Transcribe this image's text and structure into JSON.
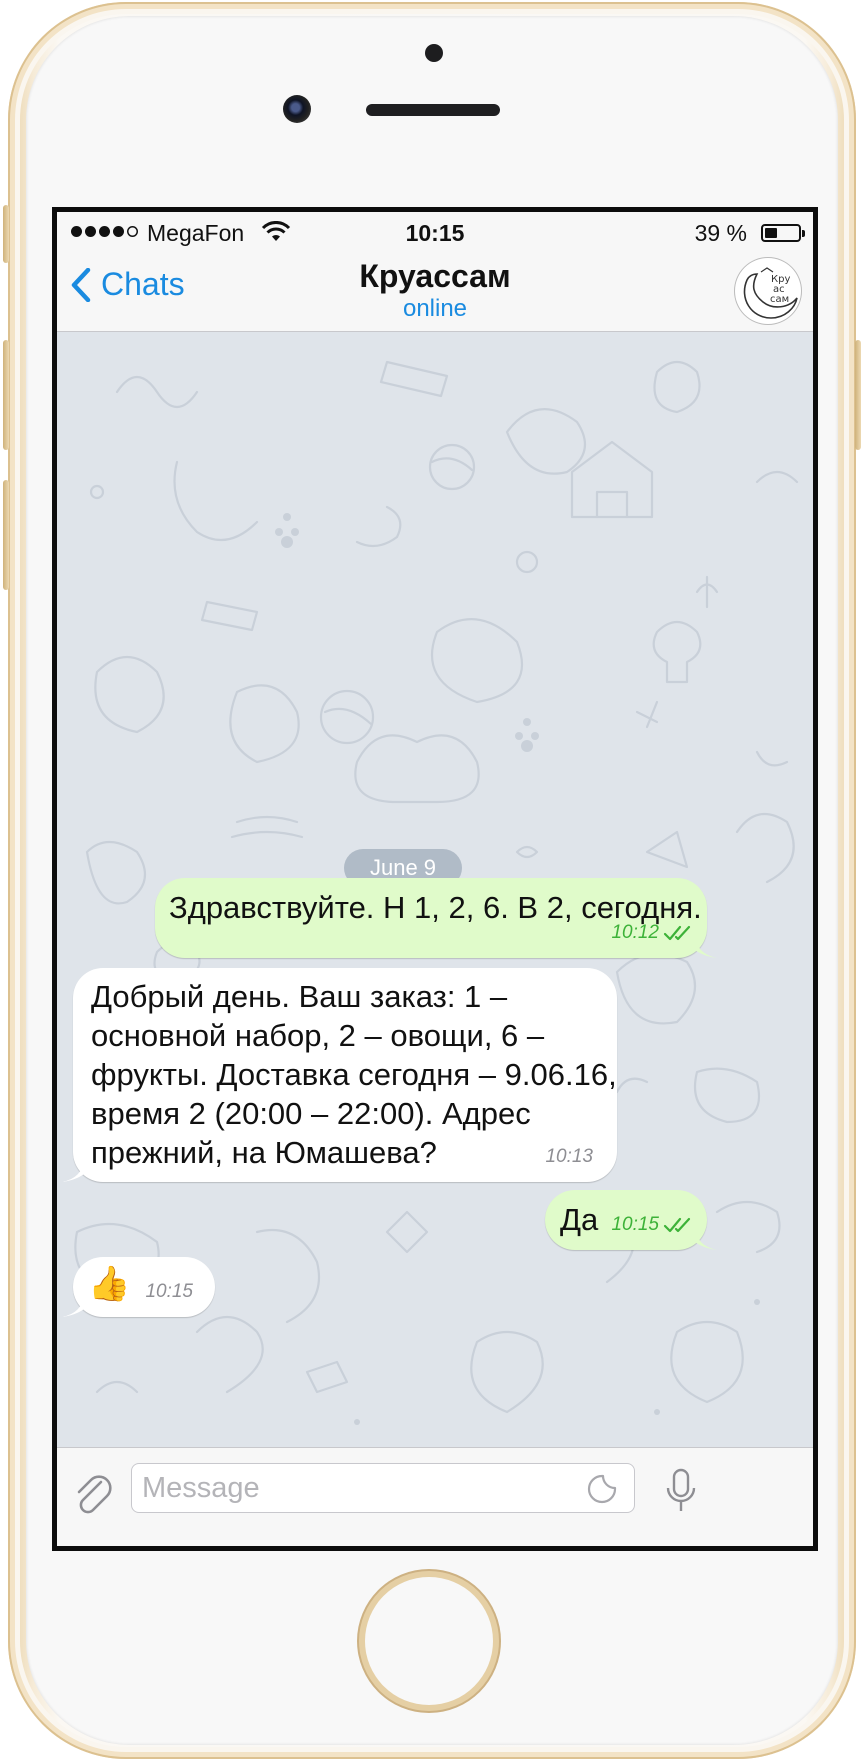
{
  "status_bar": {
    "carrier": "MegaFon",
    "time": "10:15",
    "battery_percent": "39 %",
    "battery_level": 0.39,
    "signal_bars_filled": 4,
    "signal_bars_total": 5
  },
  "header": {
    "back_label": "Chats",
    "title": "Круассам",
    "status": "online",
    "avatar_icon": "croissant-moon-logo"
  },
  "chat": {
    "date_label": "June 9",
    "messages": [
      {
        "direction": "outgoing",
        "text": "Здравствуйте. Н 1, 2, 6. В 2, сегодня.",
        "time": "10:12",
        "read": true
      },
      {
        "direction": "incoming",
        "lines": [
          "Добрый день. Ваш заказ: 1 –",
          "основной набор, 2 – овощи, 6 –",
          "фрукты. Доставка сегодня – 9.06.16,",
          "время 2 (20:00 – 22:00). Адрес",
          "прежний, на Юмашева?"
        ],
        "time": "10:13"
      },
      {
        "direction": "outgoing",
        "text": "Да",
        "time": "10:15",
        "read": true
      },
      {
        "direction": "incoming",
        "text": "👍",
        "time": "10:15"
      }
    ]
  },
  "input": {
    "placeholder": "Message"
  },
  "colors": {
    "accent": "#1a8be0",
    "outgoing_bubble": "#e0fbca",
    "incoming_bubble": "#ffffff",
    "read_check": "#3db238",
    "chat_background": "#dfe4ea"
  }
}
